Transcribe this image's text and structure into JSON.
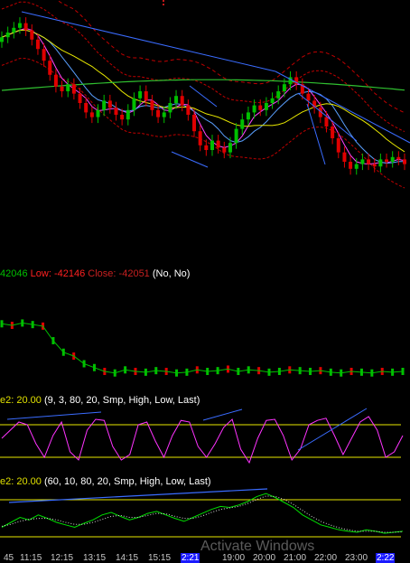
{
  "ohlc_readout": {
    "high_text": "42046",
    "low_label": "Low:",
    "low_value": "-42146",
    "close_label": "Close:",
    "close_value": "-42051",
    "flags": "(No, No)"
  },
  "stochastic_fast": {
    "key_text": "e2: 20.00",
    "params_text": "(9, 3, 80, 20, Smp, High, Low, Last)"
  },
  "stochastic_slow": {
    "key_text": "e2: 20.00",
    "params_text": "(60, 10, 80, 20, Smp, High, Low, Last)"
  },
  "time_axis": {
    "ticks": [
      "45",
      "11:15",
      "12:15",
      "13:15",
      "14:15",
      "15:15",
      "2:21",
      "19:00",
      "20:00",
      "21:00",
      "22:00",
      "23:00",
      "2:22"
    ],
    "highlighted": [
      "2:21",
      "2:22"
    ]
  },
  "watermark": "Activate Windows",
  "colors": {
    "background": "#000000",
    "bull": "#00c000",
    "bear": "#e00000",
    "trendline": "#3a6cff",
    "stoch_k": "#ff33ff",
    "stoch_slow_k": "#00e000",
    "level_line": "#e8e800",
    "ma_yellow": "#e8e800",
    "ma_green": "#30c030",
    "ma_red": "#c00000"
  },
  "chart_data": [
    {
      "type": "candlestick",
      "panel": "price",
      "title": "",
      "xlabel": "",
      "ylabel": "",
      "grid": false,
      "close": [
        78,
        80,
        82,
        84,
        81,
        77,
        73,
        68,
        62,
        57,
        55,
        58,
        54,
        50,
        46,
        44,
        47,
        51,
        48,
        45,
        43,
        47,
        52,
        55,
        51,
        47,
        44,
        46,
        50,
        53,
        49,
        45,
        38,
        32,
        30,
        34,
        31,
        29,
        33,
        39,
        43,
        46,
        49,
        47,
        50,
        52,
        55,
        58,
        61,
        58,
        54,
        51,
        48,
        44,
        40,
        35,
        29,
        25,
        22,
        24,
        26,
        24,
        23,
        26,
        25,
        27,
        26,
        24
      ],
      "overlays": [
        "moving averages",
        "envelope bands",
        "trend lines"
      ]
    },
    {
      "type": "bar",
      "panel": "volume",
      "values": [
        0.82,
        0.8,
        0.83,
        0.81,
        0.79,
        0.6,
        0.45,
        0.4,
        0.3,
        0.25,
        0.2,
        0.18,
        0.22,
        0.2,
        0.19,
        0.21,
        0.2,
        0.18,
        0.19,
        0.22,
        0.2,
        0.21,
        0.23,
        0.2,
        0.22,
        0.21,
        0.19,
        0.2,
        0.22,
        0.21,
        0.2,
        0.21,
        0.19,
        0.18,
        0.2,
        0.19,
        0.18,
        0.2,
        0.19,
        0.2
      ],
      "ylim": [
        0,
        1
      ]
    },
    {
      "type": "line",
      "panel": "stochastic_fast",
      "series": [
        {
          "values": [
            55,
            70,
            85,
            80,
            45,
            20,
            60,
            85,
            30,
            15,
            70,
            90,
            88,
            40,
            15,
            25,
            80,
            85,
            50,
            20,
            60,
            88,
            85,
            40,
            20,
            45,
            75,
            90,
            35,
            10,
            55,
            88,
            90,
            60,
            15,
            35,
            80,
            88,
            92,
            60,
            25,
            55,
            85,
            95,
            70,
            20,
            30,
            60
          ]
        }
      ],
      "levels": [
        80,
        20
      ],
      "ylim": [
        0,
        100
      ]
    },
    {
      "type": "line",
      "panel": "stochastic_slow",
      "series": [
        {
          "values": [
            30,
            40,
            50,
            45,
            55,
            48,
            40,
            35,
            30,
            38,
            45,
            55,
            60,
            52,
            45,
            50,
            58,
            62,
            55,
            48,
            42,
            50,
            58,
            66,
            72,
            70,
            75,
            82,
            92,
            98,
            90,
            80,
            70,
            55,
            45,
            35,
            30,
            25,
            22,
            20,
            25,
            22,
            18,
            20,
            22
          ]
        },
        {
          "values": [
            32,
            36,
            42,
            46,
            48,
            48,
            45,
            40,
            36,
            36,
            40,
            46,
            52,
            54,
            50,
            50,
            54,
            58,
            57,
            52,
            48,
            48,
            53,
            60,
            66,
            69,
            72,
            78,
            86,
            93,
            92,
            86,
            76,
            64,
            52,
            42,
            35,
            29,
            25,
            22,
            22,
            22,
            20,
            20,
            21
          ]
        }
      ],
      "levels": [
        80,
        20
      ],
      "ylim": [
        0,
        100
      ]
    }
  ]
}
